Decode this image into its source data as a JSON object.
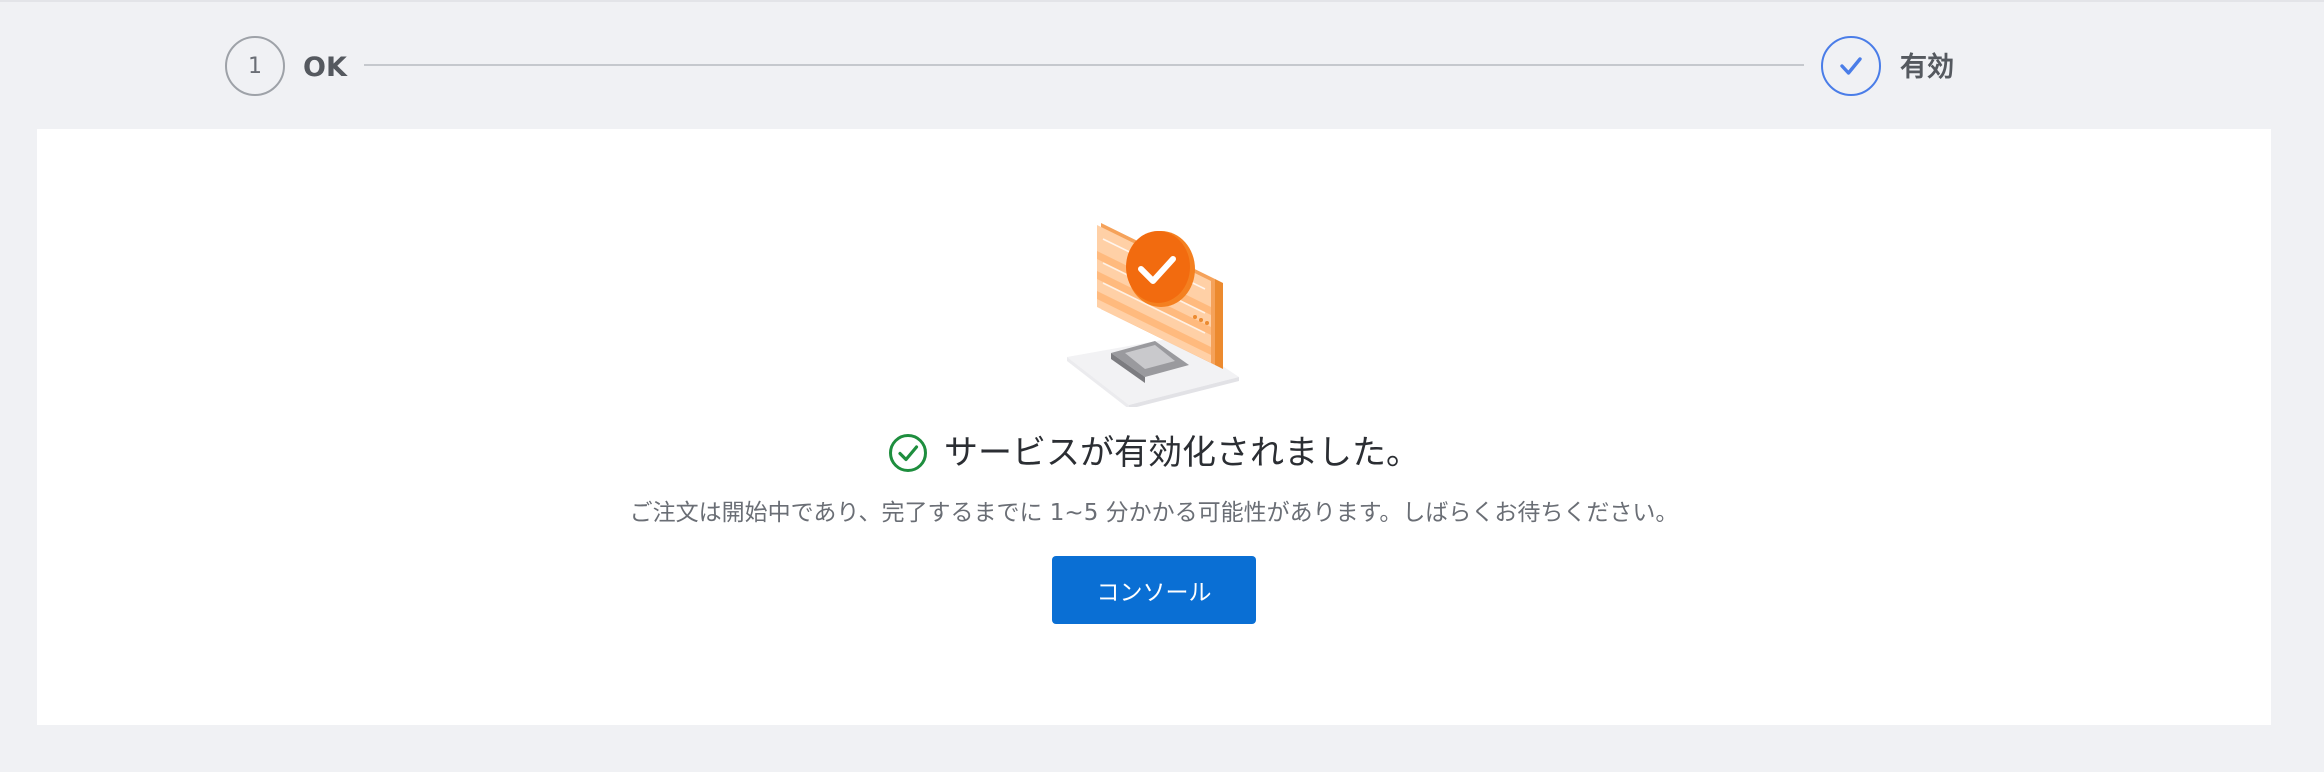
{
  "stepper": {
    "steps": [
      {
        "number": "1",
        "label": "OK",
        "state": "done"
      },
      {
        "number": "",
        "label": "有効",
        "state": "active",
        "icon": "check-icon"
      }
    ],
    "colors": {
      "active": "#4a7de8",
      "inactive": "#9ea2a8",
      "line": "#c5c8cd"
    }
  },
  "result": {
    "illustration": "monitor-checkmark-illustration",
    "status_icon": "check-circle-icon",
    "headline": "サービスが有効化されました。",
    "message": "ご注文は開始中であり、完了するまでに 1~5 分かかる可能性があります。しばらくお待ちください。",
    "button_label": "コンソール",
    "colors": {
      "success": "#1e8e3e",
      "button": "#0a6fd4",
      "accent": "#f26b0f"
    }
  }
}
